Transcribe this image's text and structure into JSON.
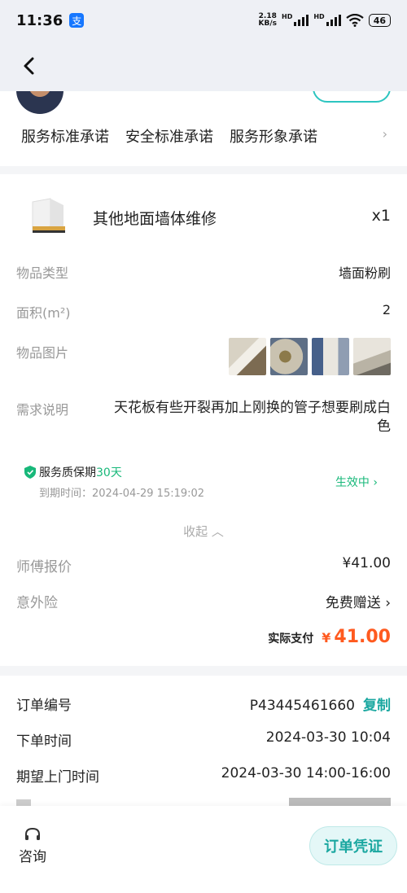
{
  "status_bar": {
    "time": "11:36",
    "pay_badge": "支",
    "net_speed_value": "2.18",
    "net_speed_unit": "KB/s",
    "hd1": "HD",
    "hd2": "HD",
    "battery": "46"
  },
  "promises": [
    "服务标准承诺",
    "安全标准承诺",
    "服务形象承诺"
  ],
  "product": {
    "title": "其他地面墙体维修",
    "quantity": "x1"
  },
  "details": {
    "item_type_label": "物品类型",
    "item_type_value": "墙面粉刷",
    "area_label": "面积(m²)",
    "area_value": "2",
    "images_label": "物品图片",
    "desc_label": "需求说明",
    "desc_value": "天花板有些开裂再加上刚换的管子想要刷成白色"
  },
  "warranty": {
    "title": "服务质保期",
    "days": "30天",
    "expiry": "到期时间：2024-04-29  15:19:02",
    "status": "生效中"
  },
  "collapse_label": "收起",
  "pricing": {
    "quote_label": "师傅报价",
    "quote_value": "¥41.00",
    "insurance_label": "意外险",
    "insurance_value": "免费赠送",
    "actual_label": "实际支付",
    "actual_currency": "¥",
    "actual_value": "41.00"
  },
  "order": {
    "number_label": "订单编号",
    "number_value": "P43445461660",
    "copy_label": "复制",
    "created_label": "下单时间",
    "created_value": "2024-03-30 10:04",
    "expected_label": "期望上门时间",
    "expected_value": "2024-03-30  14:00-16:00"
  },
  "bottom": {
    "consult_label": "咨询",
    "voucher_label": "订单凭证"
  },
  "colors": {
    "accent": "#1aa7a0",
    "green": "#18b87a",
    "price": "#ff5a1f"
  }
}
